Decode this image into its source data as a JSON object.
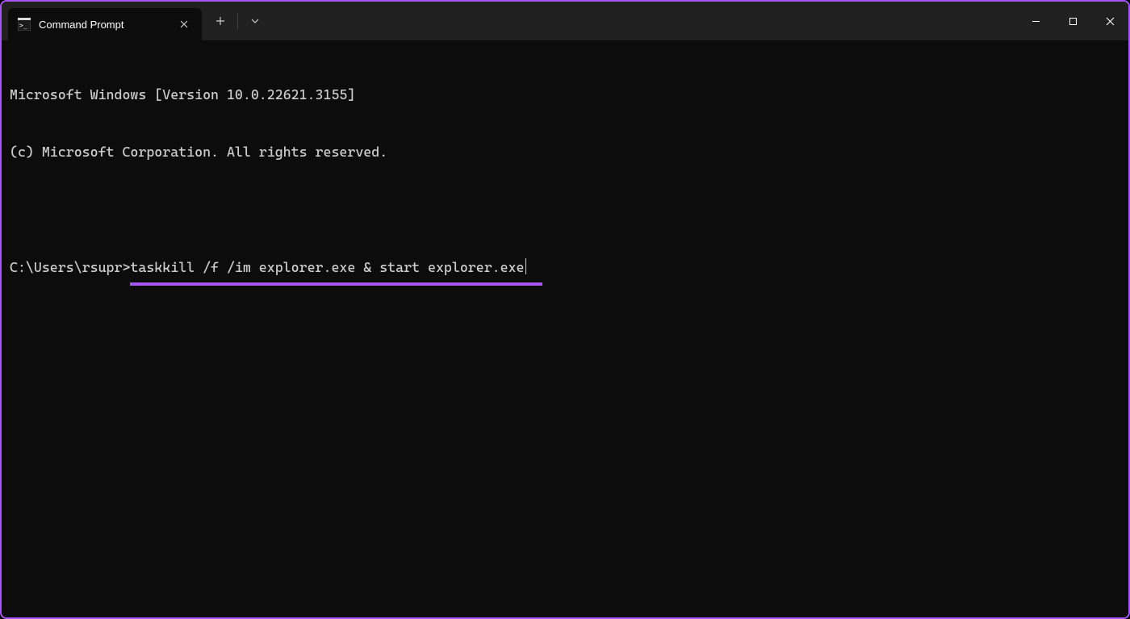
{
  "titlebar": {
    "tab": {
      "title": "Command Prompt",
      "icon": "cmd"
    }
  },
  "terminal": {
    "header_line1": "Microsoft Windows [Version 10.0.22621.3155]",
    "header_line2": "(c) Microsoft Corporation. All rights reserved.",
    "prompt": "C:\\Users\\rsupr>",
    "command": "taskkill /f /im explorer.exe & start explorer.exe"
  },
  "annotation": {
    "underline_color": "#a855f7"
  }
}
